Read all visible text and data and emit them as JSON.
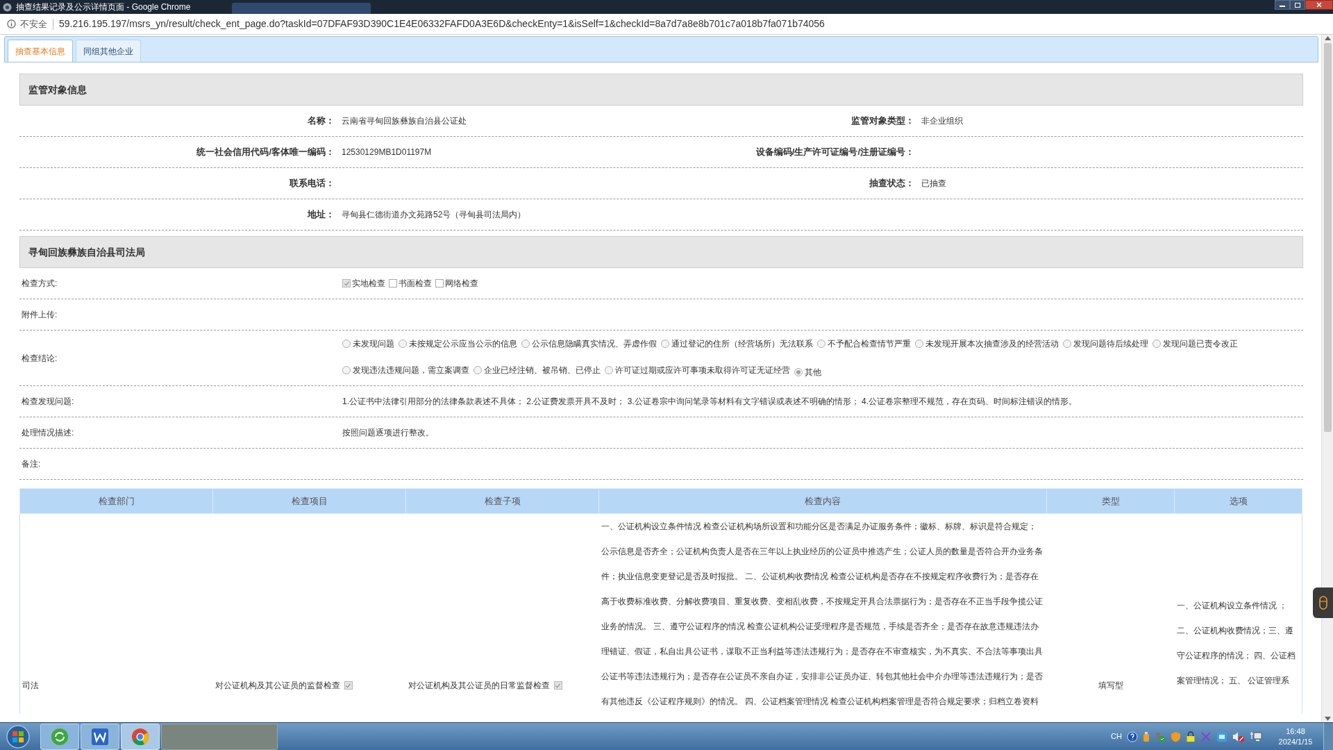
{
  "window": {
    "title": "抽查结果记录及公示详情页面 - Google Chrome"
  },
  "address_bar": {
    "security": "不安全",
    "url": "59.216.195.197/msrs_yn/result/check_ent_page.do?taskId=07DFAF93D390C1E4E06332FAFD0A3E6D&checkEnty=1&isSelf=1&checkId=8a7d7a8e8b701c7a018b7fa071b74056"
  },
  "tabs": [
    {
      "label": "抽查基本信息",
      "selected": true
    },
    {
      "label": "同组其他企业",
      "selected": false
    }
  ],
  "subject_section": {
    "title": "监管对象信息",
    "rows": [
      [
        {
          "label": "名称：",
          "value": "云南省寻甸回族彝族自治县公证处"
        },
        {
          "label": "监管对象类型：",
          "value": "非企业组织"
        }
      ],
      [
        {
          "label": "统一社会信用代码/客体唯一编码：",
          "value": "12530129MB1D01197M"
        },
        {
          "label": "设备编码/生产许可证编号/注册证编号："
        }
      ],
      [
        {
          "label": "联系电话："
        },
        {
          "label": "抽查状态：",
          "value": "已抽查"
        }
      ],
      [
        {
          "label": "地址：",
          "value": "寻甸县仁德街道办文苑路52号（寻甸县司法局内）"
        }
      ]
    ]
  },
  "inspection_section": {
    "title": "寻甸回族彝族自治县司法局",
    "fields": [
      {
        "kind": "checkboxes",
        "label": "检查方式:",
        "options": [
          {
            "label": "实地检查",
            "checked": true
          },
          {
            "label": "书面检查",
            "checked": false
          },
          {
            "label": "网络检查",
            "checked": false
          }
        ]
      },
      {
        "kind": "text",
        "label": "附件上传:"
      },
      {
        "kind": "radios",
        "label": "检查结论:",
        "options": [
          {
            "label": "未发现问题",
            "selected": false
          },
          {
            "label": "未按规定公示应当公示的信息",
            "selected": false
          },
          {
            "label": "公示信息隐瞒真实情况、弄虚作假",
            "selected": false
          },
          {
            "label": "通过登记的住所（经营场所）无法联系",
            "selected": false
          },
          {
            "label": "不予配合检查情节严重",
            "selected": false
          },
          {
            "label": "未发现开展本次抽查涉及的经营活动",
            "selected": false
          },
          {
            "label": "发现问题待后续处理",
            "selected": false
          },
          {
            "label": "发现问题已责令改正",
            "selected": false
          },
          {
            "label": "发现违法违规问题，需立案调查",
            "selected": false
          },
          {
            "label": "企业已经注销、被吊销、已停止",
            "selected": false
          },
          {
            "label": "许可证过期或应许可事项未取得许可证无证经营",
            "selected": false
          },
          {
            "label": "其他",
            "selected": true
          }
        ]
      },
      {
        "kind": "text",
        "label": "检查发现问题:",
        "value": "1.公证书中法律引用部分的法律条款表述不具体； 2.公证费发票开具不及时； 3.公证卷宗中询问笔录等材料有文字错误或表述不明确的情形； 4.公证卷宗整理不规范，存在页码、时间标注错误的情形。"
      },
      {
        "kind": "text",
        "label": "处理情况描述:",
        "value": "按照问题逐项进行整改。"
      },
      {
        "kind": "text",
        "label": "备注:"
      }
    ]
  },
  "table": {
    "columns": [
      "检查部门",
      "检查项目",
      "检查子项",
      "检查内容",
      "类型",
      "选项"
    ],
    "rows": [
      {
        "department": "司法",
        "item": {
          "label": "对公证机构及其公证员的监督检查",
          "checked": true
        },
        "subitem": {
          "label": "对公证机构及其公证员的日常监督检查",
          "checked": true
        },
        "content": "一、公证机构设立条件情况 检查公证机构场所设置和功能分区是否满足办证服务条件；徽标、标牌、标识是符合规定；公示信息是否齐全；公证机构负责人是否在三年以上执业经历的公证员中推选产生；公证人员的数量是否符合开办业务条件；执业信息变更登记是否及时报批。 二、公证机构收费情况 检查公证机构是否存在不按规定程序收费行为；是否存在高于收费标准收费、分解收费项目、重复收费、变相乱收费，不按规定开具合法票据行为；是否存在不正当手段争揽公证业务的情况。 三、遵守公证程序的情况 检查公证机构公证受理程序是否规范，手续是否齐全；是否存在故意违规违法办理错证、假证，私自出具公证书，谋取不正当利益等违法违规行为；是否存在不审查核实，为不真实、不合法等事项出具公证书等违法违规行为；是否存在公证员不亲自办证，安排非公证员办证、转包其他社会中介办理等违法违规行为；是否有其他违反《公证程序规则》的情况。 四、公证档案管理情况 检查公证机构档案管理是否符合规定要求；归档立卷资料",
        "type": "填写型",
        "options": "一、公证机构设立条件情况 ；二、公证机构收费情况；三、遵守公证程序的情况； 四、公证档案管理情况； 五、 公证管理系"
      }
    ]
  },
  "taskbar": {
    "input_language": "CH",
    "time": "16:48",
    "date": "2024/1/15"
  }
}
